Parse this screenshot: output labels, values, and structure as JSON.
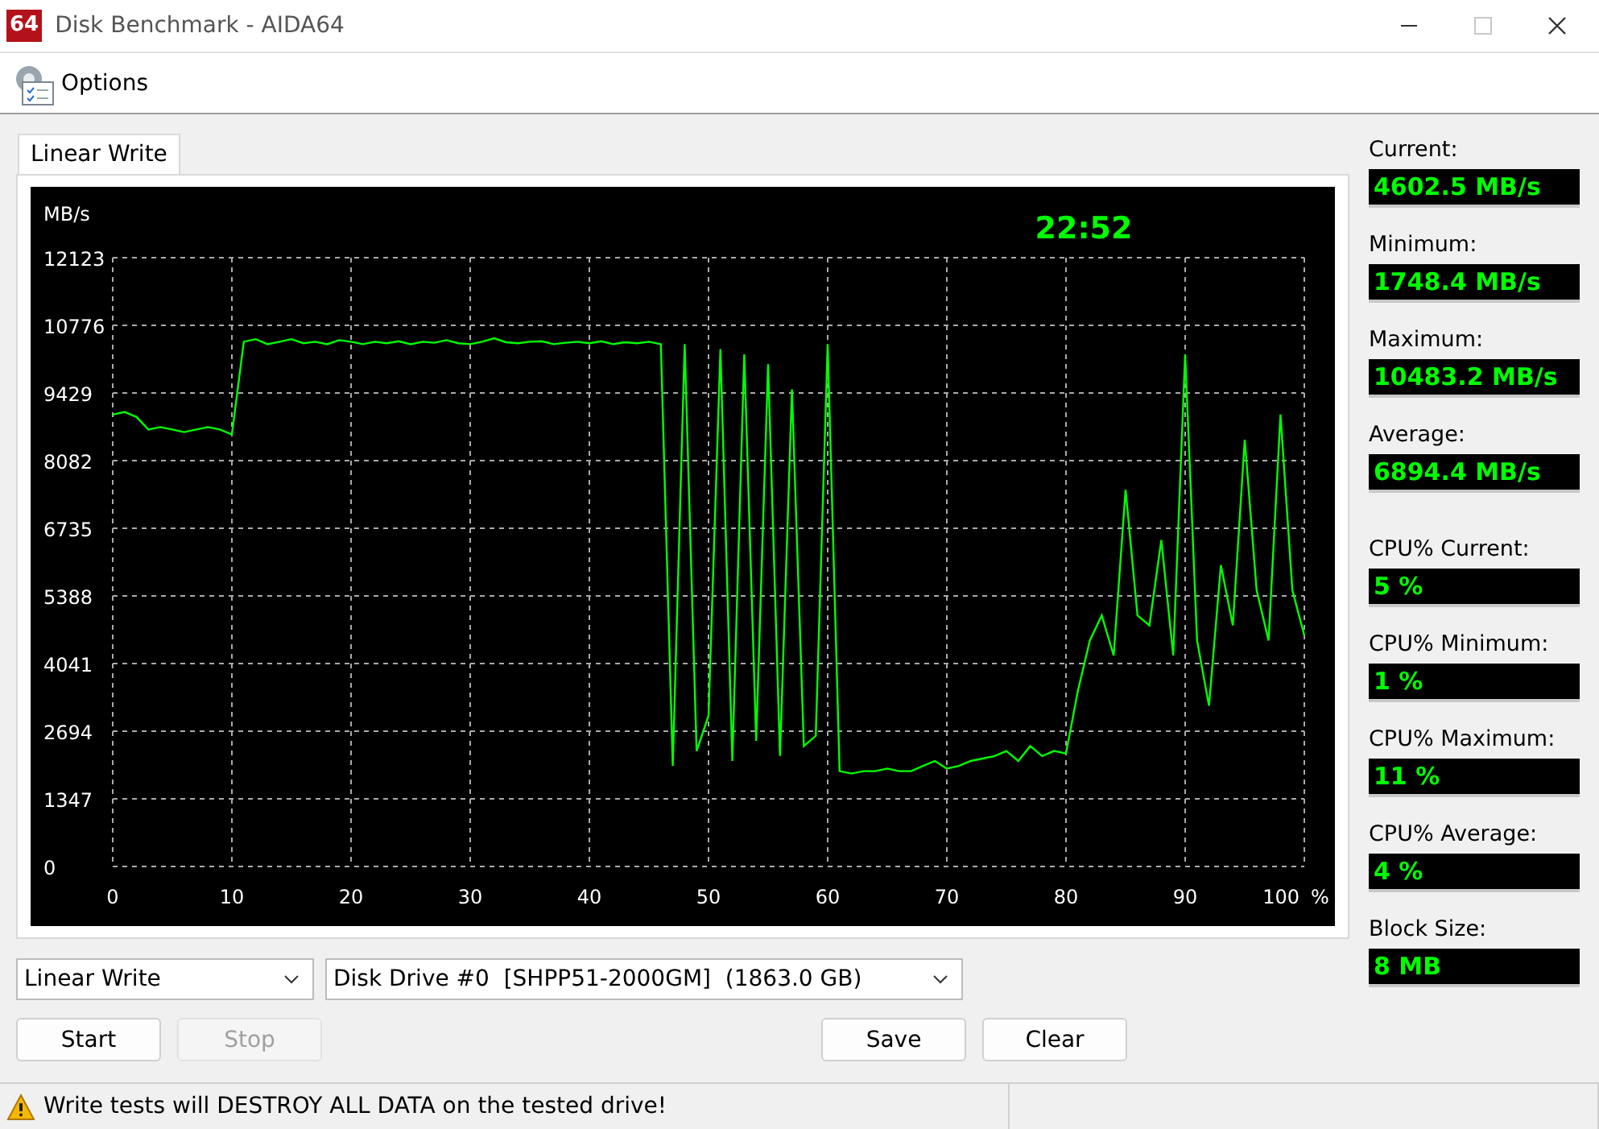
{
  "window": {
    "app_icon_text": "64",
    "title": "Disk Benchmark - AIDA64"
  },
  "menu": {
    "label": "Options"
  },
  "tabs": [
    {
      "label": "Linear Write",
      "selected": true
    }
  ],
  "chart": {
    "elapsed": "22:52",
    "chart_data": {
      "type": "line",
      "grid": true,
      "ylabel": "MB/s",
      "xlabel": "%",
      "xlim": [
        0,
        100
      ],
      "ylim": [
        0,
        12123
      ],
      "xticks": [
        0,
        10,
        20,
        30,
        40,
        50,
        60,
        70,
        80,
        90,
        100
      ],
      "yticks": [
        0,
        1347,
        2694,
        4041,
        5388,
        6735,
        8082,
        9429,
        10776,
        12123
      ],
      "x": [
        0,
        1,
        2,
        3,
        4,
        5,
        6,
        7,
        8,
        9,
        10,
        11,
        12,
        13,
        14,
        15,
        16,
        17,
        18,
        19,
        20,
        21,
        22,
        23,
        24,
        25,
        26,
        27,
        28,
        29,
        30,
        31,
        32,
        33,
        34,
        35,
        36,
        37,
        38,
        39,
        40,
        41,
        42,
        43,
        44,
        45,
        46,
        47,
        48,
        49,
        50,
        51,
        52,
        53,
        54,
        55,
        56,
        57,
        58,
        59,
        60,
        61,
        62,
        63,
        64,
        65,
        66,
        67,
        68,
        69,
        70,
        71,
        72,
        73,
        74,
        75,
        76,
        77,
        78,
        79,
        80,
        81,
        82,
        83,
        84,
        85,
        86,
        87,
        88,
        89,
        90,
        91,
        92,
        93,
        94,
        95,
        96,
        97,
        98,
        99,
        100
      ],
      "series": [
        {
          "color": "#00ff00",
          "values": [
            9000,
            9050,
            8950,
            8700,
            8750,
            8700,
            8650,
            8700,
            8750,
            8700,
            8600,
            10450,
            10500,
            10400,
            10450,
            10500,
            10420,
            10450,
            10400,
            10480,
            10450,
            10400,
            10450,
            10420,
            10460,
            10400,
            10450,
            10430,
            10480,
            10420,
            10400,
            10450,
            10520,
            10440,
            10420,
            10450,
            10460,
            10400,
            10430,
            10450,
            10420,
            10460,
            10400,
            10440,
            10420,
            10450,
            10400,
            2000,
            10400,
            2300,
            3000,
            10300,
            2100,
            10200,
            2500,
            10000,
            2200,
            9500,
            2400,
            2600,
            10400,
            1900,
            1850,
            1900,
            1900,
            1950,
            1900,
            1900,
            2000,
            2100,
            1950,
            2000,
            2100,
            2150,
            2200,
            2300,
            2100,
            2400,
            2200,
            2300,
            2250,
            3500,
            4500,
            5000,
            4200,
            7500,
            5000,
            4800,
            6500,
            4200,
            10200,
            4500,
            3200,
            6000,
            4800,
            8500,
            5500,
            4500,
            9000,
            5500,
            4600
          ]
        }
      ]
    }
  },
  "stats": [
    {
      "label": "Current:",
      "value": "4602.5 MB/s"
    },
    {
      "label": "Minimum:",
      "value": "1748.4 MB/s"
    },
    {
      "label": "Maximum:",
      "value": "10483.2 MB/s"
    },
    {
      "label": "Average:",
      "value": "6894.4 MB/s"
    }
  ],
  "cpu_stats": [
    {
      "label": "CPU% Current:",
      "value": "5 %"
    },
    {
      "label": "CPU% Minimum:",
      "value": "1 %"
    },
    {
      "label": "CPU% Maximum:",
      "value": "11 %"
    },
    {
      "label": "CPU% Average:",
      "value": "4 %"
    },
    {
      "label": "Block Size:",
      "value": "8 MB"
    }
  ],
  "test_select": {
    "value": "Linear Write"
  },
  "drive_select": {
    "value": "Disk Drive #0  [SHPP51-2000GM]  (1863.0 GB)"
  },
  "buttons": [
    {
      "label": "Start",
      "disabled": false
    },
    {
      "label": "Stop",
      "disabled": true
    },
    {
      "label": "Save",
      "disabled": false
    },
    {
      "label": "Clear",
      "disabled": false
    }
  ],
  "status_bar": {
    "message": "Write tests will DESTROY ALL DATA on the tested drive!"
  }
}
